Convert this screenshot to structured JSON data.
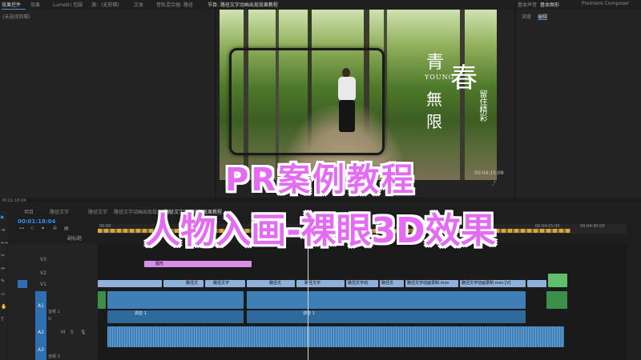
{
  "source_panel": {
    "tabs": [
      "效果控件",
      "效果",
      "Lumetri 范围",
      "源：(无剪辑)",
      "文本",
      "音轨混合器: 路径"
    ],
    "empty_text": "(未选择剪辑)",
    "timecode": "00:01:18:04"
  },
  "program_panel": {
    "title": "节目: 路径文字动画出现效果教程",
    "timecode": "00:04:15:09",
    "video_text": {
      "qing": "青",
      "young": "YOUNG",
      "wu": "無",
      "xian": "限",
      "chun": "春",
      "side": "留住精彩"
    }
  },
  "right_panel": {
    "tabs": [
      "基本声音",
      "基本图形",
      "Premiere Composer"
    ],
    "subtabs": [
      "浏览",
      "编辑"
    ]
  },
  "timeline": {
    "project_tab_left": "项目",
    "project_tab_name": "路径文字",
    "seq_tabs": [
      "路径文字",
      "路径文字动画出现效果演示",
      "路径文字动画出现效果教程"
    ],
    "timecode": "00:01:18:04",
    "ruler_labels": [
      "00:00",
      "00:04:15:00",
      "00:04:30:00"
    ],
    "subtitle_label": "副标题",
    "tracks": [
      {
        "name": "V3"
      },
      {
        "name": "V2"
      },
      {
        "name": "V1"
      },
      {
        "name": "A1",
        "label": "音频 1"
      },
      {
        "name": "A2"
      },
      {
        "name": "A3",
        "label": "音频 3"
      }
    ],
    "graphic_clip": "图形",
    "video_clips": [
      "路径文",
      "路径文字",
      "路径文",
      "路径文字",
      "路径文字动",
      "路径文",
      "路径文字动画录制.mov",
      "路径文字动画录制.mov [V]"
    ],
    "audio_clip": "调音 1",
    "track_label_o": "O"
  },
  "overlay": {
    "line1": "PR案例教程",
    "line2": "人物入画-裸眼3D效果"
  },
  "colors": {
    "accent_blue": "#2f8ff0",
    "overlay_purple": "#e36cf2",
    "graphic_clip_pink": "#d88de6",
    "video_clip": "#8fb0d8",
    "audio_clip": "#3f7fb8",
    "green_clip": "#5fbf6a"
  }
}
